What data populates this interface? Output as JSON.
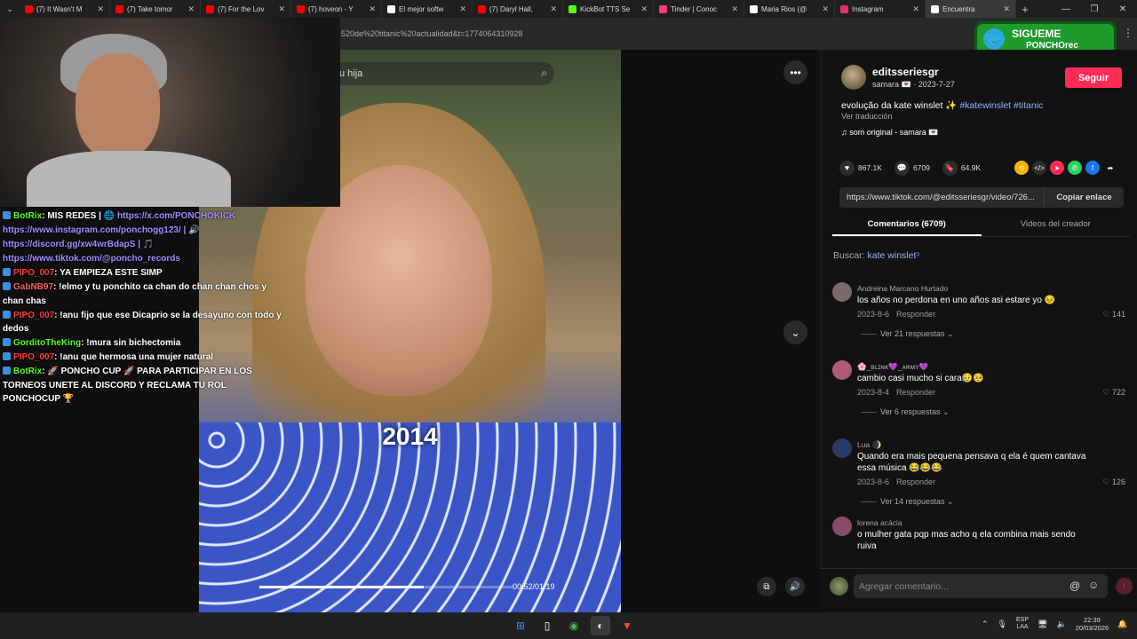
{
  "browser": {
    "tabs": [
      {
        "title": "(7) It Wasn't M",
        "color": "#ff0000"
      },
      {
        "title": "(7) Take tomor",
        "color": "#ff0000"
      },
      {
        "title": "(7) For the Lov",
        "color": "#ff0000"
      },
      {
        "title": "(7) hoveon - Y",
        "color": "#ff0000"
      },
      {
        "title": "El mejor softw",
        "color": "#ffffff"
      },
      {
        "title": "(7) Daryl Hall, ",
        "color": "#ff0000"
      },
      {
        "title": "KickBot TTS Se",
        "color": "#53fc18"
      },
      {
        "title": "Tinder | Conoc",
        "color": "#fe3c72"
      },
      {
        "title": "Maria Rios (@",
        "color": "#ffffff"
      },
      {
        "title": "Instagram",
        "color": "#e1306c"
      },
      {
        "title": "Encuentra",
        "color": "#ffffff",
        "active": true
      }
    ],
    "url": "520de%20titanic%20actualidad&t=1774064310928"
  },
  "video": {
    "search_text": "u hija",
    "year_overlay": "2014",
    "timecode": "00:52/01:19",
    "progress": 0.65
  },
  "webcam": {
    "label": "streamer webcam"
  },
  "chat": [
    {
      "user": "BotRix",
      "user_color": "#53fc18",
      "text": ": MIS REDES | 🌐 ",
      "link": "https://x.com/PONCHOKICK"
    },
    {
      "user": "",
      "user_color": "#ffffff",
      "text": "",
      "link": "https://www.instagram.com/ponchogg123/ | 🔊"
    },
    {
      "user": "",
      "user_color": "#ffffff",
      "text": "",
      "link": "https://discord.gg/xw4wrBdapS | 🎵"
    },
    {
      "user": "",
      "user_color": "#ffffff",
      "text": "",
      "link": "https://www.tiktok.com/@poncho_records"
    },
    {
      "user": "PIPO_007",
      "user_color": "#ff3b3b",
      "text": ": YA EMPIEZA ESTE SIMP",
      "link": ""
    },
    {
      "user": "GabNB97",
      "user_color": "#ff5a5a",
      "text": ": !elmo y tu ponchito ca chan do chan chan chos y chan chas",
      "link": ""
    },
    {
      "user": "PIPO_007",
      "user_color": "#ff3b3b",
      "text": ": !anu fijo que ese Dicaprio se la desayuno con todo y dedos",
      "link": ""
    },
    {
      "user": "GorditoTheKing",
      "user_color": "#53fc18",
      "text": ": !mura sin bichectomia",
      "link": ""
    },
    {
      "user": "PIPO_007",
      "user_color": "#ff3b3b",
      "text": ": !anu que hermosa una mujer natural",
      "link": ""
    },
    {
      "user": "BotRix",
      "user_color": "#53fc18",
      "text": ": 🚀 PONCHO CUP 🚀 PARA PARTICIPAR EN LOS TORNEOS UNETE AL DISCORD Y RECLAMA TU ROL PONCHOCUP 🏆",
      "link": ""
    }
  ],
  "banner": {
    "line1": "SIGUEME",
    "line2": "PONCHOrec"
  },
  "post": {
    "username": "editsseriesgr",
    "subline": "samara 💌 · 2023-7-27",
    "follow_label": "Seguir",
    "caption": "evolução da kate winslet ✨ ",
    "tags": "#katewinslet #titanic",
    "translate": "Ver traducción",
    "sound": "♫  som original - samara 💌",
    "likes": "867.1K",
    "comments_count": "6709",
    "saves": "64.9K",
    "link": "https://www.tiktok.com/@editsseriesgr/video/726...",
    "copy_label": "Copiar enlace",
    "tab_comments": "Comentarios (6709)",
    "tab_creator": "Videos del creador",
    "search_label": "Buscar: ",
    "search_query": "kate winslet"
  },
  "comments": [
    {
      "name": "Andreina Marcano Hurtado",
      "text": "los años no perdona en uno años asi estare yo 😣",
      "date": "2023-8-6",
      "reply": "Responder",
      "likes": "♡ 141",
      "replies": "Ver 21 respuestas ⌄",
      "avatar": "#7a6a6a"
    },
    {
      "name": "🌸_ʙʟɪɴᴋ💜_ᴀʀᴍʏ💜",
      "text": "cambio casi mucho si cara😥🥺",
      "date": "2023-8-4",
      "reply": "Responder",
      "likes": "♡ 722",
      "replies": "Ver 6 respuestas ⌄",
      "avatar": "#b05a7a"
    },
    {
      "name": "Lua 🌒",
      "text": "Quando era mais pequena pensava q ela é quem cantava essa música 😂😂😂",
      "date": "2023-8-6",
      "reply": "Responder",
      "likes": "♡ 126",
      "replies": "Ver 14 respuestas ⌄",
      "avatar": "#2a3a6a"
    },
    {
      "name": "lorena  acácia",
      "text": "o mulher gata pqp mas acho q ela combina mais sendo ruiva",
      "date": "",
      "reply": "",
      "likes": "",
      "replies": "",
      "avatar": "#8a4a6a"
    }
  ],
  "comment_bar": {
    "placeholder": "Agregar comentario..."
  },
  "taskbar": {
    "lang1": "ESP",
    "lang2": "LAA",
    "time": "22:39",
    "date": "20/03/2026"
  }
}
